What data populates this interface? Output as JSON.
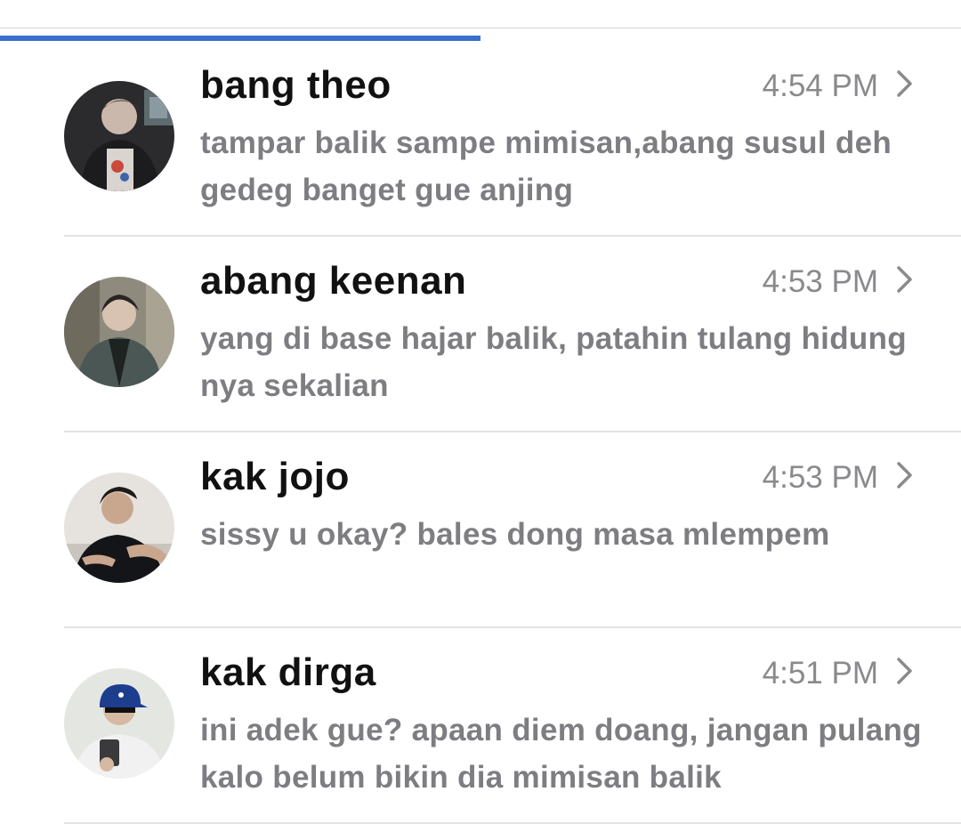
{
  "progress": {
    "fraction": 0.5,
    "color": "#3a6fd0"
  },
  "conversations": [
    {
      "name": "bang theo",
      "time": "4:54 PM",
      "preview": "tampar balik sampe mimisan,abang susul deh gedeg banget gue anjing",
      "avatar_icon": "profile-photo-icon"
    },
    {
      "name": "abang keenan",
      "time": "4:53 PM",
      "preview": "yang di base hajar balik, patahin tulang hidung nya sekalian",
      "avatar_icon": "profile-photo-icon"
    },
    {
      "name": "kak jojo",
      "time": "4:53 PM",
      "preview": "sissy u okay? bales dong masa mlempem",
      "avatar_icon": "profile-photo-icon"
    },
    {
      "name": "kak dirga",
      "time": "4:51 PM",
      "preview": "ini adek gue? apaan diem doang, jangan pulang kalo belum bikin dia mimisan balik",
      "avatar_icon": "profile-photo-icon"
    }
  ],
  "chevron_icon": "chevron-right-icon"
}
